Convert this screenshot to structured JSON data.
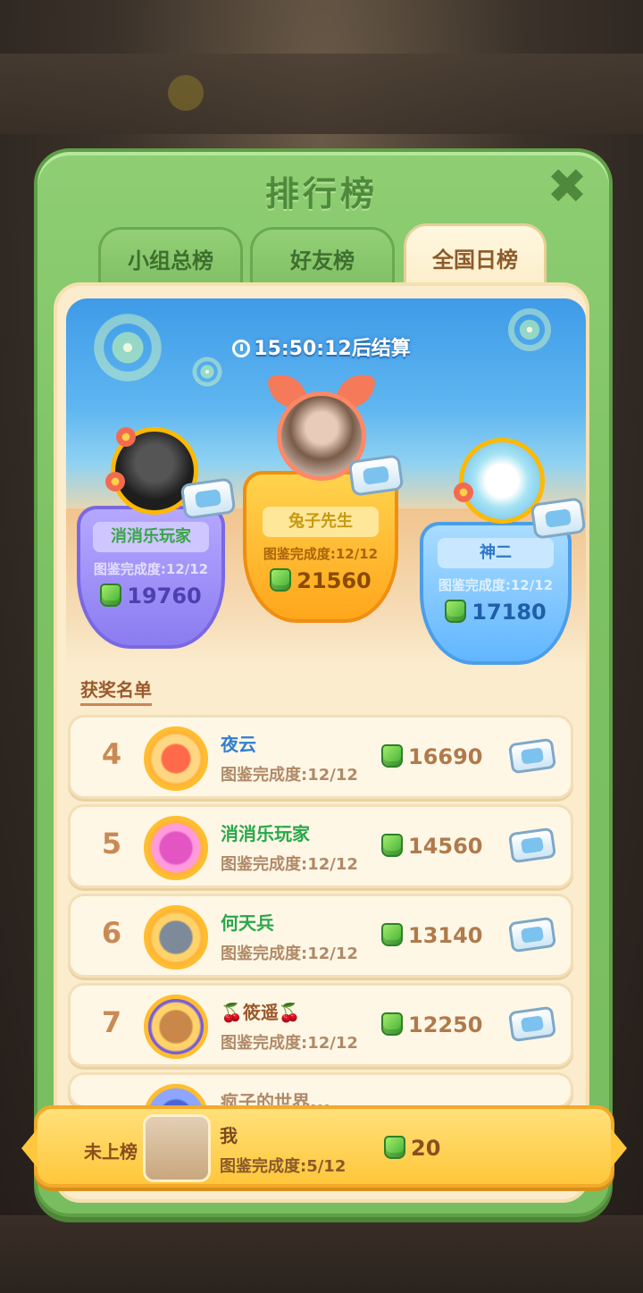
{
  "title": "排行榜",
  "tabs": [
    {
      "label": "小组总榜"
    },
    {
      "label": "好友榜"
    },
    {
      "label": "全国日榜"
    }
  ],
  "timer": "15:50:12后结算",
  "podium": {
    "second": {
      "name": "消消乐玩家",
      "progress": "图鉴完成度:12/12",
      "score": "19760"
    },
    "first": {
      "name": "兔子先生",
      "progress": "图鉴完成度:12/12",
      "score": "21560"
    },
    "third": {
      "name": "神二",
      "progress": "图鉴完成度:12/12",
      "score": "17180"
    }
  },
  "awards_label": "获奖名单",
  "ranks": [
    {
      "rank": "4",
      "name": "夜云",
      "progress": "图鉴完成度:12/12",
      "score": "16690"
    },
    {
      "rank": "5",
      "name": "消消乐玩家",
      "progress": "图鉴完成度:12/12",
      "score": "14560"
    },
    {
      "rank": "6",
      "name": "何天兵",
      "progress": "图鉴完成度:12/12",
      "score": "13140"
    },
    {
      "rank": "7",
      "name": "🍒筱遥🍒",
      "progress": "图鉴完成度:12/12",
      "score": "12250"
    },
    {
      "rank": "",
      "name": "疯子的世界...",
      "progress": "",
      "score": ""
    }
  ],
  "me": {
    "rank_label": "未上榜",
    "name": "我",
    "progress": "图鉴完成度:5/12",
    "score": "20"
  },
  "colors": {
    "panel_green": "#7cc163",
    "cream": "#fbeccd",
    "gold": "#ffc73b"
  }
}
